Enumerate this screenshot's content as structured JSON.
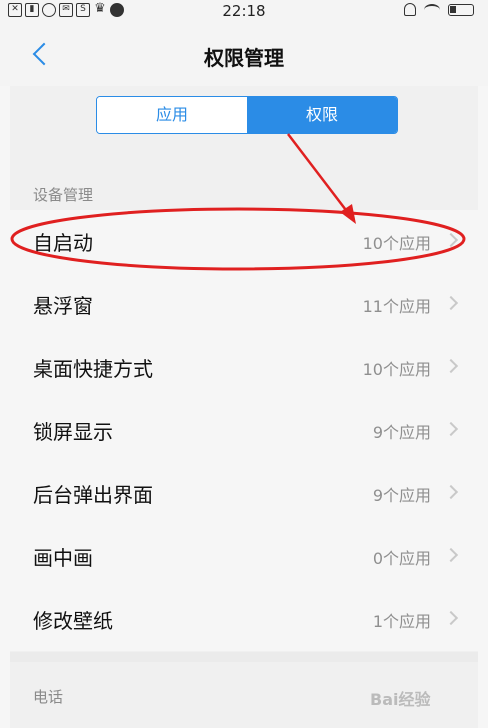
{
  "status_bar": {
    "time": "22:18",
    "left_icons": [
      "x-icon",
      "sim-icon",
      "search-icon",
      "mail-icon",
      "s-icon",
      "crown-icon",
      "chat-icon"
    ],
    "right_icons": [
      "bell-off-icon",
      "wifi-icon",
      "battery-icon"
    ]
  },
  "header": {
    "title": "权限管理",
    "back_icon": "chevron-left-icon"
  },
  "tabs": {
    "items": [
      {
        "label": "应用",
        "selected": false
      },
      {
        "label": "权限",
        "selected": true
      }
    ],
    "accent_color": "#2b8ce6"
  },
  "sections": {
    "device_management": "设备管理",
    "phone": "电话"
  },
  "permissions": [
    {
      "label": "自启动",
      "count": "10个应用"
    },
    {
      "label": "悬浮窗",
      "count": "11个应用"
    },
    {
      "label": "桌面快捷方式",
      "count": "10个应用"
    },
    {
      "label": "锁屏显示",
      "count": "9个应用"
    },
    {
      "label": "后台弹出界面",
      "count": "9个应用"
    },
    {
      "label": "画中画",
      "count": "0个应用"
    },
    {
      "label": "修改壁纸",
      "count": "1个应用"
    }
  ],
  "annotation": {
    "color": "#e02020",
    "highlighted_item": "自启动"
  },
  "watermark": "Bai经验"
}
